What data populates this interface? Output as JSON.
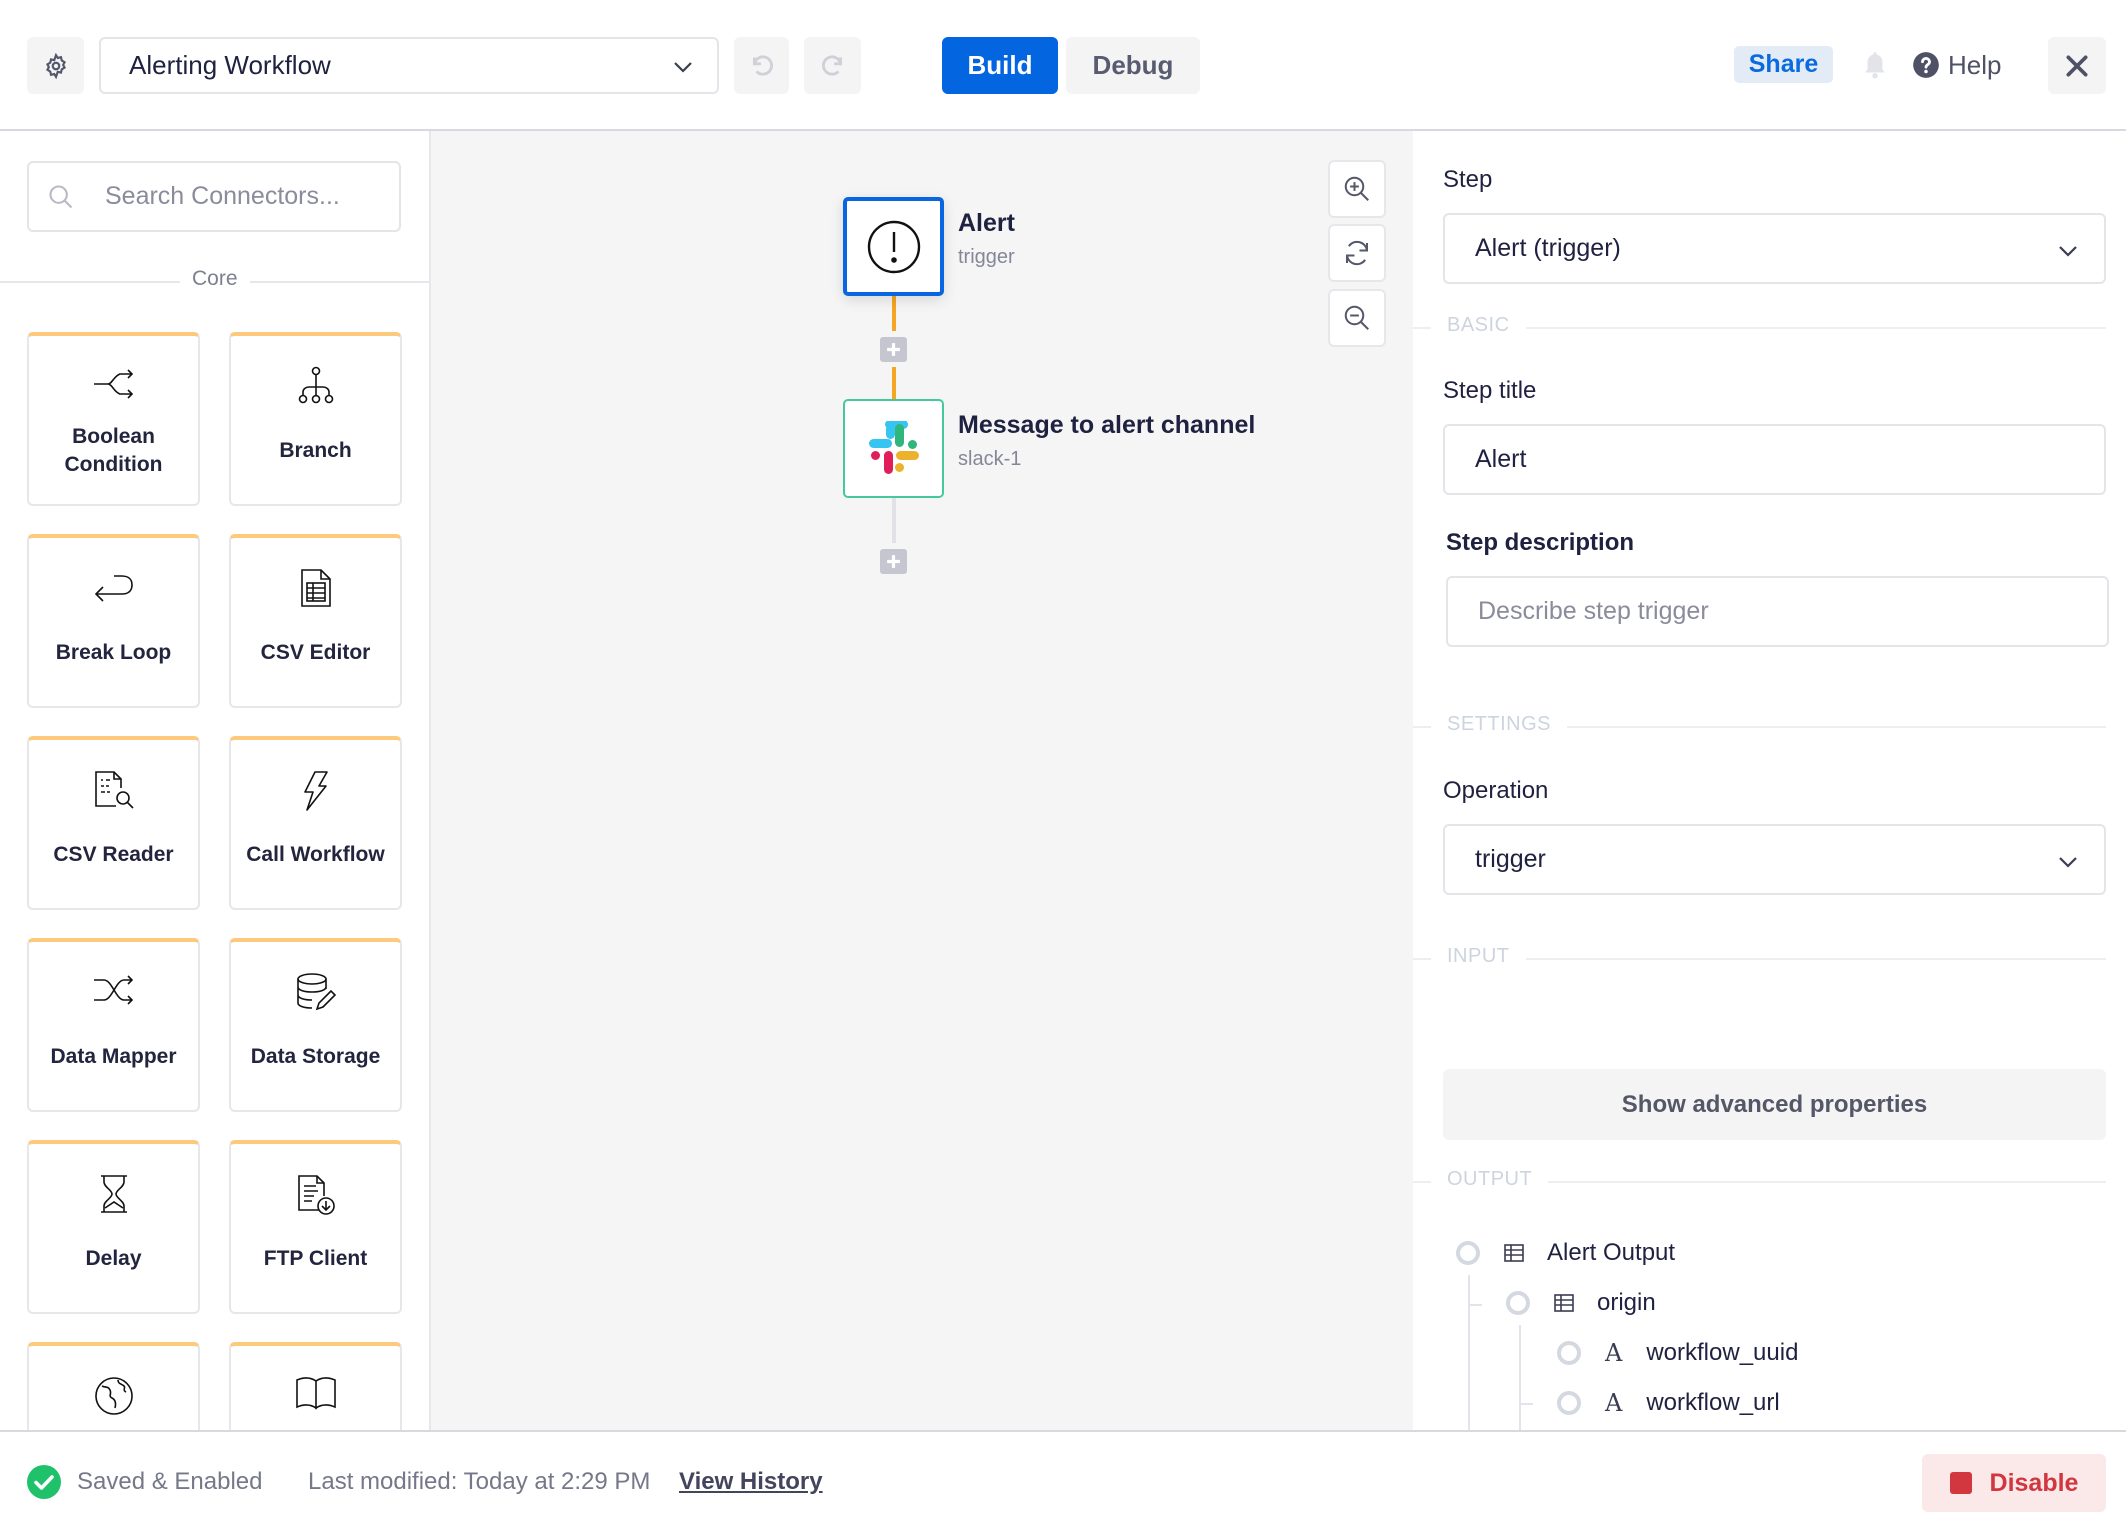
{
  "header": {
    "workflow_name": "Alerting Workflow",
    "modes": {
      "build": "Build",
      "debug": "Debug"
    },
    "active_mode": "Build",
    "share_label": "Share",
    "help_label": "Help"
  },
  "palette": {
    "search_placeholder": "Search Connectors...",
    "section_label": "Core",
    "connectors": [
      {
        "label": "Boolean Condition",
        "icon": "boolean-condition-icon"
      },
      {
        "label": "Branch",
        "icon": "branch-icon"
      },
      {
        "label": "Break Loop",
        "icon": "break-loop-icon"
      },
      {
        "label": "CSV Editor",
        "icon": "csv-editor-icon"
      },
      {
        "label": "CSV Reader",
        "icon": "csv-reader-icon"
      },
      {
        "label": "Call Workflow",
        "icon": "lightning-icon"
      },
      {
        "label": "Data Mapper",
        "icon": "shuffle-icon"
      },
      {
        "label": "Data Storage",
        "icon": "database-edit-icon"
      },
      {
        "label": "Delay",
        "icon": "hourglass-icon"
      },
      {
        "label": "FTP Client",
        "icon": "file-download-icon"
      },
      {
        "label": "",
        "icon": "globe-icon"
      },
      {
        "label": "",
        "icon": "book-icon"
      }
    ],
    "accent_color": "#fdc97c"
  },
  "canvas": {
    "steps": [
      {
        "title": "Alert",
        "subtitle": "trigger",
        "icon": "alert-circle-icon",
        "selected": true
      },
      {
        "title": "Message to alert channel",
        "subtitle": "slack-1",
        "icon": "slack-icon",
        "selected": false
      }
    ],
    "connector_color": "#f5a623"
  },
  "properties": {
    "step_label": "Step",
    "step_value": "Alert (trigger)",
    "basic_section": "BASIC",
    "title_label": "Step title",
    "title_value": "Alert",
    "description_label": "Step description",
    "description_placeholder": "Describe step trigger",
    "settings_section": "SETTINGS",
    "operation_label": "Operation",
    "operation_value": "trigger",
    "input_section": "INPUT",
    "advanced_label": "Show advanced properties",
    "output_section": "OUTPUT",
    "output_tree": [
      {
        "label": "Alert Output",
        "type": "object",
        "depth": 0
      },
      {
        "label": "origin",
        "type": "object",
        "depth": 1
      },
      {
        "label": "workflow_uuid",
        "type": "string",
        "depth": 2
      },
      {
        "label": "workflow_url",
        "type": "string",
        "depth": 2
      }
    ]
  },
  "footer": {
    "status": "Saved & Enabled",
    "last_modified": "Last modified: Today at 2:29 PM",
    "history_link": "View History",
    "disable_label": "Disable",
    "status_color": "#1fc16b",
    "danger_color": "#d2373f"
  }
}
